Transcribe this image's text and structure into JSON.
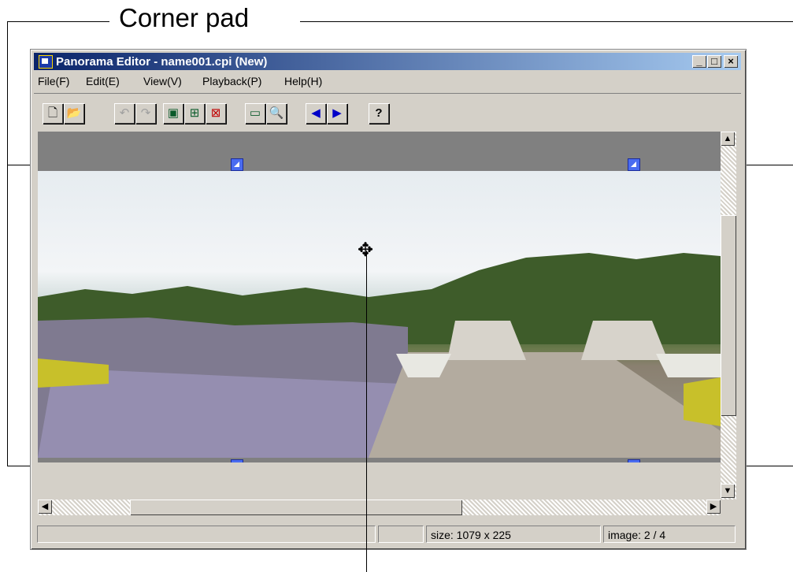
{
  "callout": {
    "title": "Corner pad"
  },
  "window": {
    "title": "Panorama Editor - name001.cpi (New)",
    "controls": {
      "minimize": "_",
      "maximize": "□",
      "close": "×"
    }
  },
  "menu": {
    "items": [
      {
        "label": "File(F)"
      },
      {
        "label": "Edit(E)"
      },
      {
        "label": "View(V)"
      },
      {
        "label": "Playback(P)"
      },
      {
        "label": "Help(H)"
      }
    ]
  },
  "toolbar": {
    "buttons": [
      {
        "icon": "new-document-icon",
        "glyph": "🗋",
        "enabled": true
      },
      {
        "icon": "open-folder-icon",
        "glyph": "📂",
        "enabled": true
      },
      {
        "icon": "undo-icon",
        "glyph": "↶",
        "enabled": false
      },
      {
        "icon": "redo-icon",
        "glyph": "↷",
        "enabled": false
      },
      {
        "icon": "insert-image-icon",
        "glyph": "▣",
        "enabled": true
      },
      {
        "icon": "split-image-icon",
        "glyph": "⊞",
        "enabled": true
      },
      {
        "icon": "delete-image-icon",
        "glyph": "⊠",
        "enabled": true
      },
      {
        "icon": "preview-icon",
        "glyph": "▭",
        "enabled": true
      },
      {
        "icon": "zoom-icon",
        "glyph": "🔍",
        "enabled": true
      },
      {
        "icon": "previous-icon",
        "glyph": "◀",
        "enabled": true
      },
      {
        "icon": "next-icon",
        "glyph": "▶",
        "enabled": true
      },
      {
        "icon": "help-icon",
        "glyph": "?",
        "enabled": true
      }
    ]
  },
  "status": {
    "size": "size: 1079 x 225",
    "image": "image: 2 / 4"
  },
  "colors": {
    "titlebar_start": "#0a246a",
    "titlebar_end": "#a6caf0",
    "corner_pad": "#4a6cf0",
    "canvas": "#808080"
  }
}
